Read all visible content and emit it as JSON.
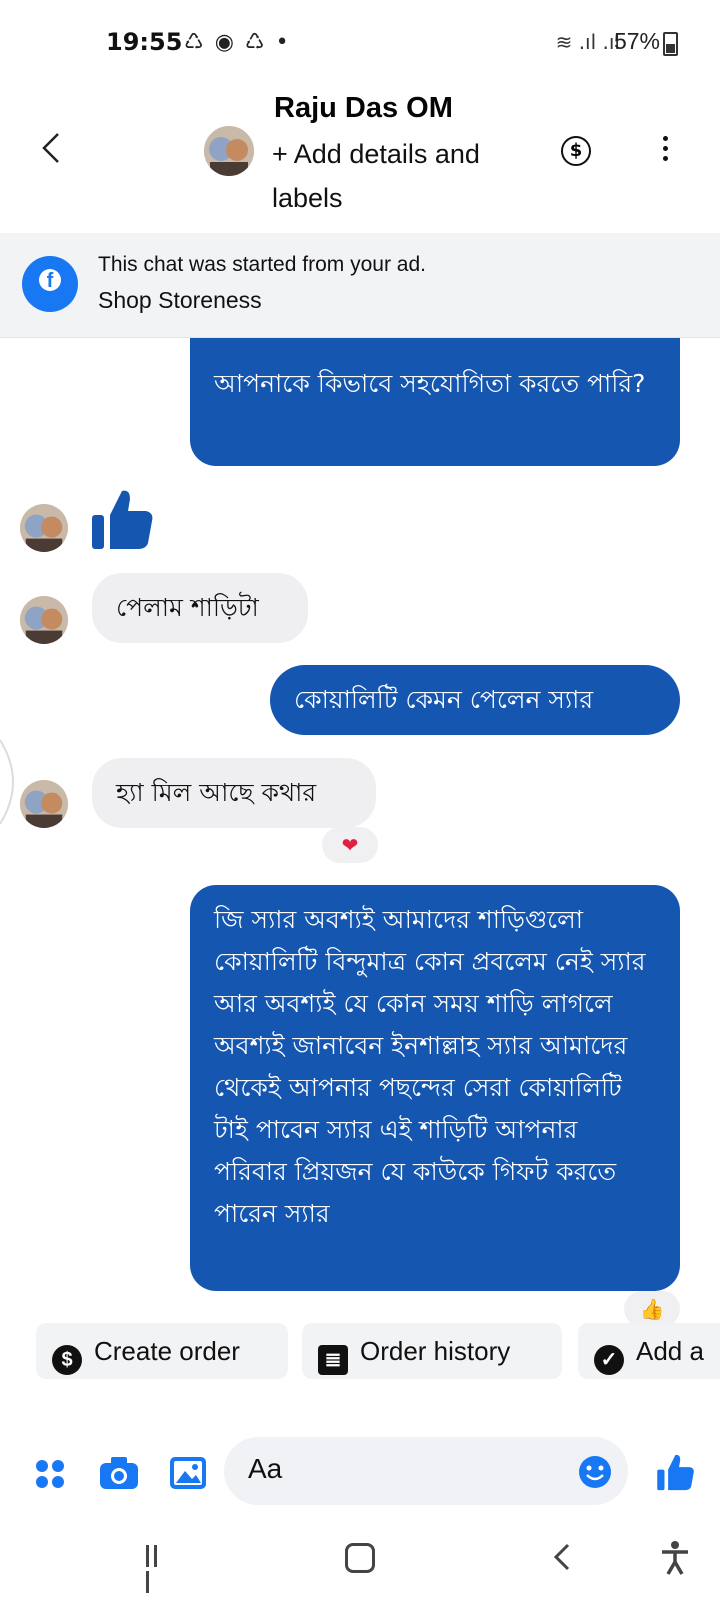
{
  "status_bar": {
    "time": "19:55",
    "notification_icons": "♺ ◉ ♺ •",
    "signal": "≋ .ıl .ıl",
    "battery": "57%"
  },
  "header": {
    "name": "Raju Das OM",
    "subtitle": "+ Add details and labels",
    "dollar_symbol": "$"
  },
  "ad_banner": {
    "line1": "This chat was started from your ad.",
    "line2": "Shop Storeness",
    "icon_letter": "f"
  },
  "messages": [
    {
      "from": "me",
      "text": "আপনাকে কিভাবে সহযোগিতা করতে পারি?"
    },
    {
      "from": "them",
      "type": "like"
    },
    {
      "from": "them",
      "text": "পেলাম শাড়িটা"
    },
    {
      "from": "me",
      "text": "কোয়ালিটি কেমন পেলেন স্যার"
    },
    {
      "from": "them",
      "text": "হ্যা মিল আছে কথার",
      "reaction": "❤"
    },
    {
      "from": "me",
      "text": "জি স্যার অবশ্যই আমাদের শাড়িগুলো কোয়ালিটি বিন্দুমাত্র কোন প্রবলেম নেই স্যার আর অবশ্যই যে কোন সময় শাড়ি লাগলে অবশ্যই জানাবেন ইনশাল্লাহ স্যার আমাদের থেকেই আপনার পছন্দের সেরা কোয়ালিটি টাই পাবেন স্যার এই শাড়িটি আপনার পরিবার প্রিয়জন যে কাউকে  গিফট করতে পারেন স্যার",
      "reaction": "👍"
    }
  ],
  "quick_replies": [
    {
      "label": "Create order",
      "icon": "dollar-circle-icon",
      "glyph": "$"
    },
    {
      "label": "Order history",
      "icon": "list-icon",
      "glyph": "≣"
    },
    {
      "label": "Add a",
      "icon": "check-circle-icon",
      "glyph": "✓"
    }
  ],
  "composer": {
    "placeholder": "Aa"
  },
  "colors": {
    "outgoing_bubble": "#1556b0",
    "incoming_bubble": "#efeff1",
    "accent": "#1877f2"
  }
}
